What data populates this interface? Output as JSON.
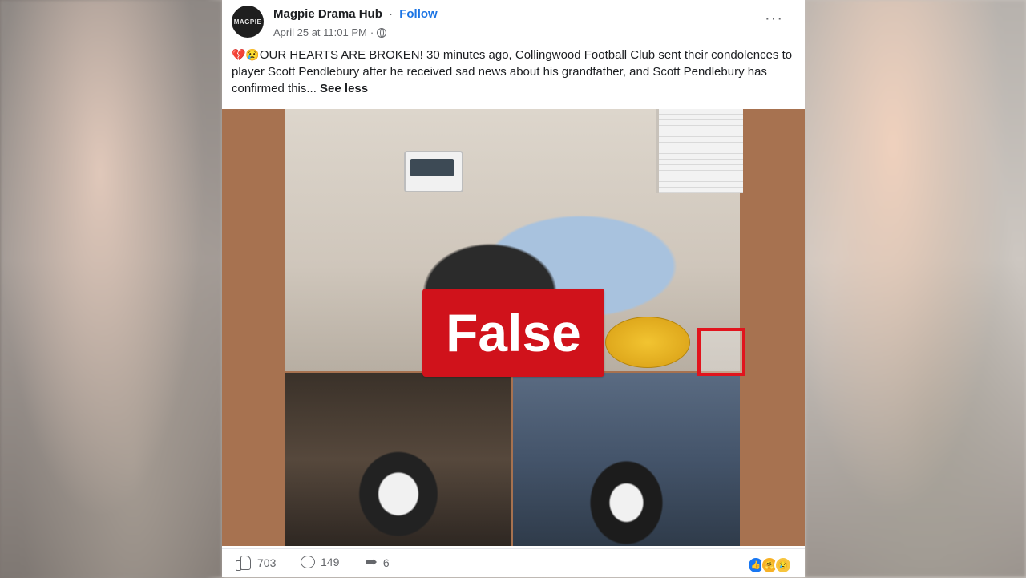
{
  "post": {
    "author": "Magpie Drama Hub",
    "avatar_text": "MAGPIE",
    "separator": "·",
    "follow": "Follow",
    "timestamp": "April 25 at 11:01 PM",
    "meta_separator": "·",
    "more_icon": "···",
    "emoji_prefix": "💔😢",
    "text": "OUR HEARTS ARE BROKEN! 30 minutes ago, Collingwood Football Club sent their condolences to player Scott Pendlebury after he received sad news about his grandfather, and Scott Pendlebury has confirmed this...",
    "see_less": "See less"
  },
  "overlay": {
    "false_label": "False"
  },
  "actions": {
    "likes": "703",
    "comments": "149",
    "shares": "6",
    "share_icon": "➦"
  },
  "reactions": [
    {
      "name": "like",
      "glyph": "👍"
    },
    {
      "name": "care",
      "glyph": "🤗"
    },
    {
      "name": "sad",
      "glyph": "😢"
    }
  ],
  "colors": {
    "follow": "#1b74e4",
    "false_badge": "#d0121b",
    "media_background": "#a77250"
  }
}
